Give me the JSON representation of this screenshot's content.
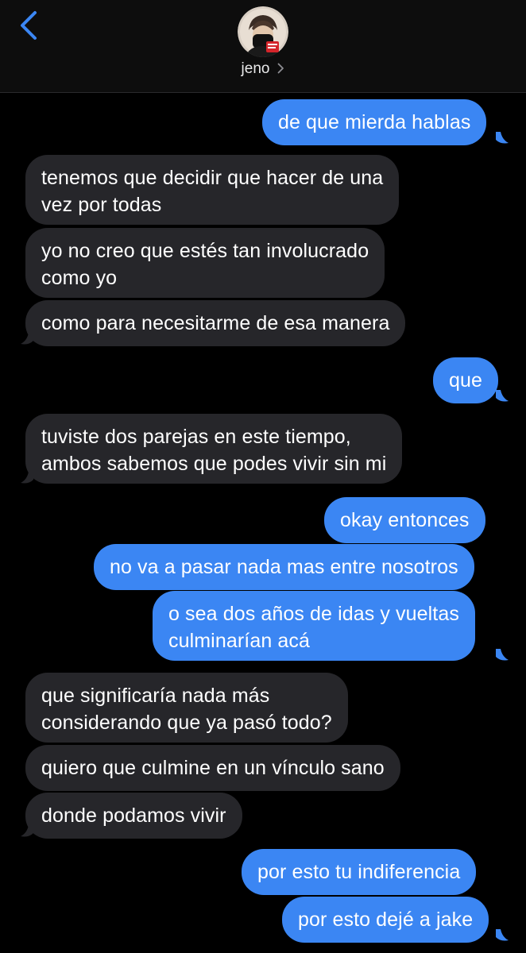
{
  "header": {
    "back_icon": "chevron-left-icon",
    "contact_name": "jeno",
    "contact_chevron": "›",
    "avatar_icon": "contact-photo"
  },
  "colors": {
    "outgoing": "#3b86f3",
    "incoming": "#26262a",
    "accent": "#3b86f3",
    "background": "#000000"
  },
  "messages": [
    {
      "sender": "me",
      "text": "de que mierda hablas"
    },
    {
      "sender": "jeno",
      "lines": [
        "tenemos que decidir que hacer de una",
        "vez por todas"
      ]
    },
    {
      "sender": "jeno",
      "lines": [
        "yo no creo que estés tan involucrado",
        "como yo"
      ]
    },
    {
      "sender": "jeno",
      "text": "como para necesitarme de esa manera"
    },
    {
      "sender": "me",
      "text": "que"
    },
    {
      "sender": "jeno",
      "lines": [
        "tuviste dos parejas en este tiempo,",
        "ambos sabemos que podes vivir sin mi"
      ]
    },
    {
      "sender": "me",
      "text": "okay entonces"
    },
    {
      "sender": "me",
      "text": "no va a pasar nada mas entre nosotros"
    },
    {
      "sender": "me",
      "lines": [
        "o sea dos años de idas y vueltas",
        "culminarían acá"
      ]
    },
    {
      "sender": "jeno",
      "lines": [
        "que significaría nada más",
        "considerando que ya pasó todo?"
      ]
    },
    {
      "sender": "jeno",
      "text": "quiero que culmine en un vínculo sano"
    },
    {
      "sender": "jeno",
      "text": "donde podamos vivir"
    },
    {
      "sender": "me",
      "text": "por esto tu indiferencia"
    },
    {
      "sender": "me",
      "text": "por esto dejé a jake"
    }
  ]
}
